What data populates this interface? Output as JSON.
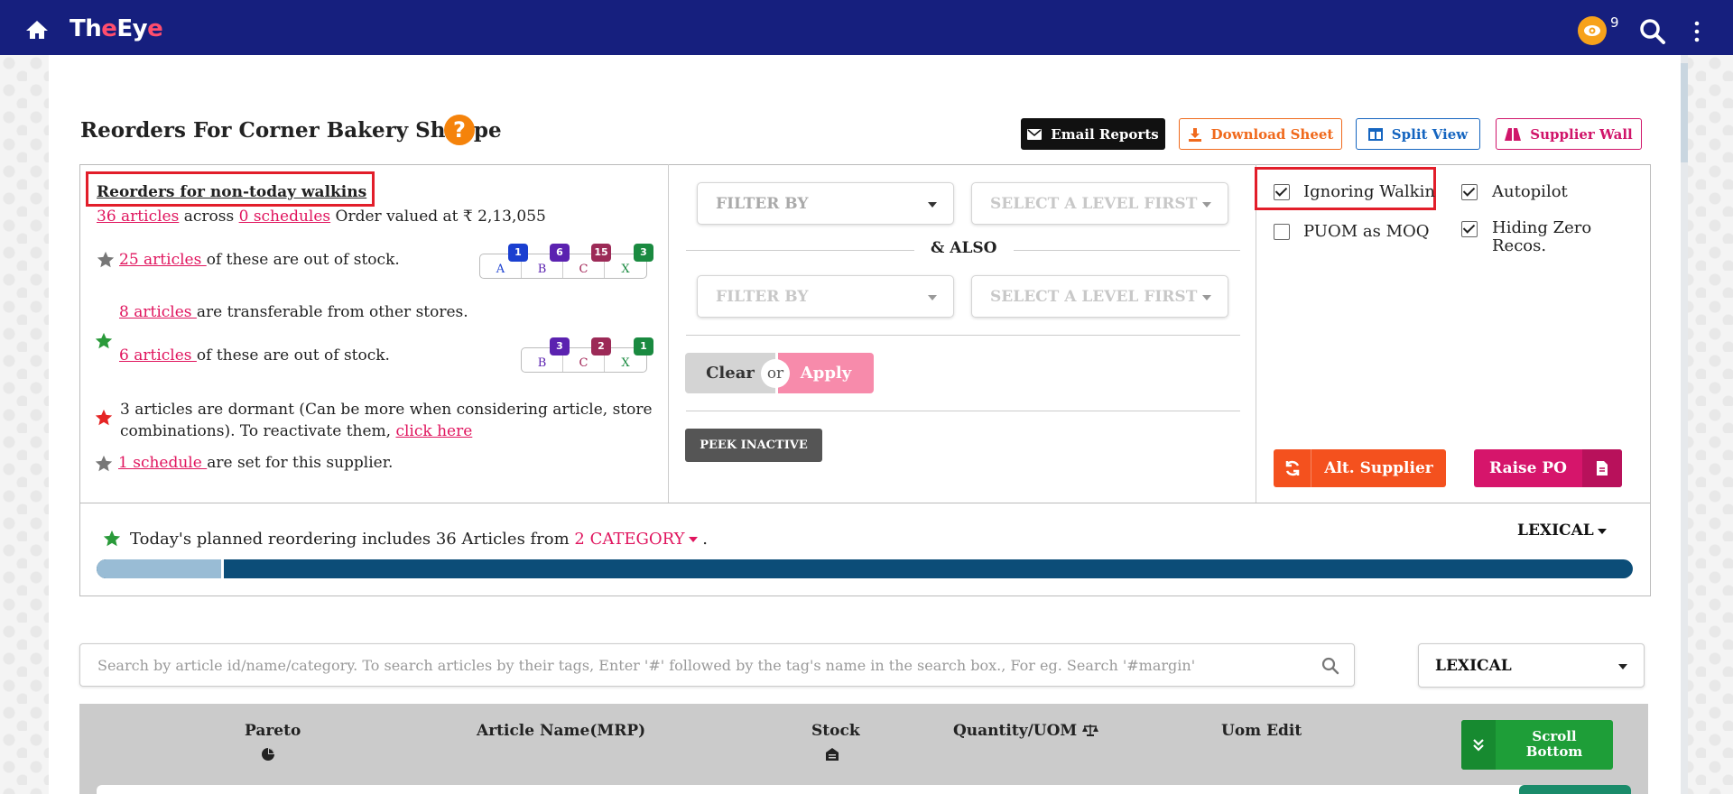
{
  "app": {
    "logo_prefix": "Th",
    "logo_e": "e",
    "logo_suffix": "Ey",
    "logo_e2": "e",
    "eye_count": "9"
  },
  "header": {
    "title": "Reorders For Corner Bakery Shoppe",
    "help": "?",
    "buttons": {
      "email": "Email Reports",
      "download": "Download Sheet",
      "split": "Split View",
      "supplier_wall": "Supplier Wall"
    }
  },
  "summary": {
    "title": "Reorders for non-today walkins",
    "articles_link": "36 articles",
    "across": " across ",
    "schedules_link": "0 schedules",
    "order_value": " Order valued at ₹ 2,13,055",
    "out_of_stock": {
      "link": "25 articles ",
      "text": "of these are out of stock.",
      "grades": [
        {
          "label": "A",
          "count": "1",
          "label_color": "#1a3fd0",
          "badge_color": "#1a3fd0"
        },
        {
          "label": "B",
          "count": "6",
          "label_color": "#5b22b0",
          "badge_color": "#5b22b0"
        },
        {
          "label": "C",
          "count": "15",
          "label_color": "#a12355",
          "badge_color": "#9c2a57"
        },
        {
          "label": "X",
          "count": "3",
          "label_color": "#1a8a40",
          "badge_color": "#1a8a40"
        }
      ]
    },
    "transferable": {
      "link": "8 articles ",
      "text": "are transferable from other stores."
    },
    "transfer_out": {
      "link": "6 articles ",
      "text": "of these are out of stock.",
      "grades": [
        {
          "label": "B",
          "count": "3",
          "label_color": "#5b22b0",
          "badge_color": "#5b22b0"
        },
        {
          "label": "C",
          "count": "2",
          "label_color": "#a12355",
          "badge_color": "#9c2a57"
        },
        {
          "label": "X",
          "count": "1",
          "label_color": "#1a8a40",
          "badge_color": "#1a8a40"
        }
      ]
    },
    "dormant": {
      "line1": "3 articles are dormant (Can be more when considering article, store",
      "line2": "combinations). To reactivate them, ",
      "link": "click here"
    },
    "schedule": {
      "link": "1 schedule ",
      "text": "are set for this supplier."
    }
  },
  "filters": {
    "filter1": "FILTER BY",
    "level1": "SELECT A LEVEL FIRST",
    "also": "& ALSO",
    "filter2": "FILTER BY",
    "level2": "SELECT A LEVEL FIRST",
    "clear": "Clear",
    "or": "or",
    "apply": "Apply",
    "peek": "PEEK INACTIVE"
  },
  "options": {
    "ignoring_walkin": {
      "label": "Ignoring Walkin",
      "checked": true
    },
    "autopilot": {
      "label": "Autopilot",
      "checked": true
    },
    "puom_moq": {
      "label": "PUOM as MOQ",
      "checked": false
    },
    "hiding_zero_line1": "Hiding Zero",
    "hiding_zero_line2": "Recos.",
    "alt_supplier": "Alt. Supplier",
    "raise_po": "Raise PO"
  },
  "planned": {
    "text": "Today's planned reordering includes 36 Articles from ",
    "category": "2 CATEGORY",
    "suffix": " .",
    "sort": "LEXICAL"
  },
  "search": {
    "placeholder": "Search by article id/name/category. To search articles by their tags, Enter '#' followed by the tag's name in the search box., For eg. Search '#margin'",
    "sort_value": "LEXICAL"
  },
  "table": {
    "headers": {
      "pareto": "Pareto",
      "article": "Article Name(MRP)",
      "stock": "Stock",
      "quantity": "Quantity/UOM",
      "uom_edit": "Uom Edit"
    },
    "scroll_line1": "Scroll",
    "scroll_line2": "Bottom"
  },
  "colors": {
    "topbar": "#161f7e",
    "accent_pink": "#e0155e",
    "progress_dark": "#0c4d78",
    "progress_light": "#99bcd5"
  },
  "progress": {
    "fraction": 0.083
  }
}
